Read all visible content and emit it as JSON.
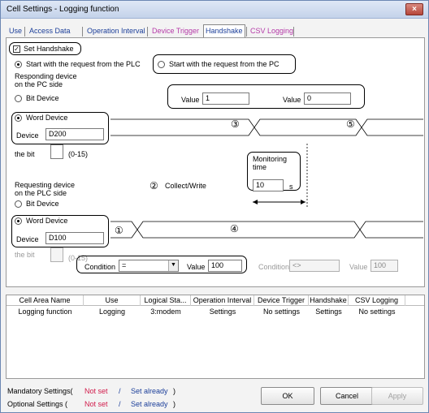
{
  "window": {
    "title": "Cell Settings - Logging function",
    "close": "×"
  },
  "tabs": [
    "Use",
    "Access Data",
    "Operation Interval",
    "Device Trigger",
    "Handshake",
    "CSV Logging"
  ],
  "handshake": {
    "set_handshake": "Set Handshake",
    "opt_plc": "Start with the request from the PLC",
    "opt_pc": "Start with the request from the PC",
    "responding_label_1": "Responding device",
    "responding_label_2": "on the PC side",
    "bit_device": "Bit Device",
    "word_device": "Word Device",
    "device": "Device",
    "responding_device_value": "D200",
    "value_label": "Value",
    "value_1": "1",
    "value_2": "0",
    "the_bit": "the bit",
    "bit_range": "(0-15)",
    "monitoring_1": "Monitoring",
    "monitoring_2": "time",
    "monitoring_value": "10",
    "monitoring_unit": "s",
    "requesting_label_1": "Requesting device",
    "requesting_label_2": "on the PLC side",
    "collect_marker": "②",
    "collect_write": "Collect/Write",
    "requesting_device_value": "D100",
    "condition_label": "Condition",
    "condition_value": "=",
    "condition_number": "100",
    "condition2_value": "<>",
    "condition2_number": "100",
    "markers": {
      "m1": "①",
      "m3": "③",
      "m4": "④",
      "m5": "⑤"
    }
  },
  "table": {
    "headers": [
      "Cell Area Name",
      "Use",
      "Logical Sta...",
      "Operation Interval",
      "Device Trigger",
      "Handshake",
      "CSV Logging"
    ],
    "rows": [
      [
        "Logging function",
        "Logging",
        "3:modem",
        "Settings",
        "No settings",
        "Settings",
        "No settings"
      ]
    ]
  },
  "status": {
    "mandatory": "Mandatory Settings(",
    "optional": "Optional Settings  (",
    "not_set": "Not set",
    "slash": "/",
    "set_already": "Set already",
    "close_paren": ")"
  },
  "buttons": {
    "ok": "OK",
    "cancel": "Cancel",
    "apply": "Apply"
  }
}
